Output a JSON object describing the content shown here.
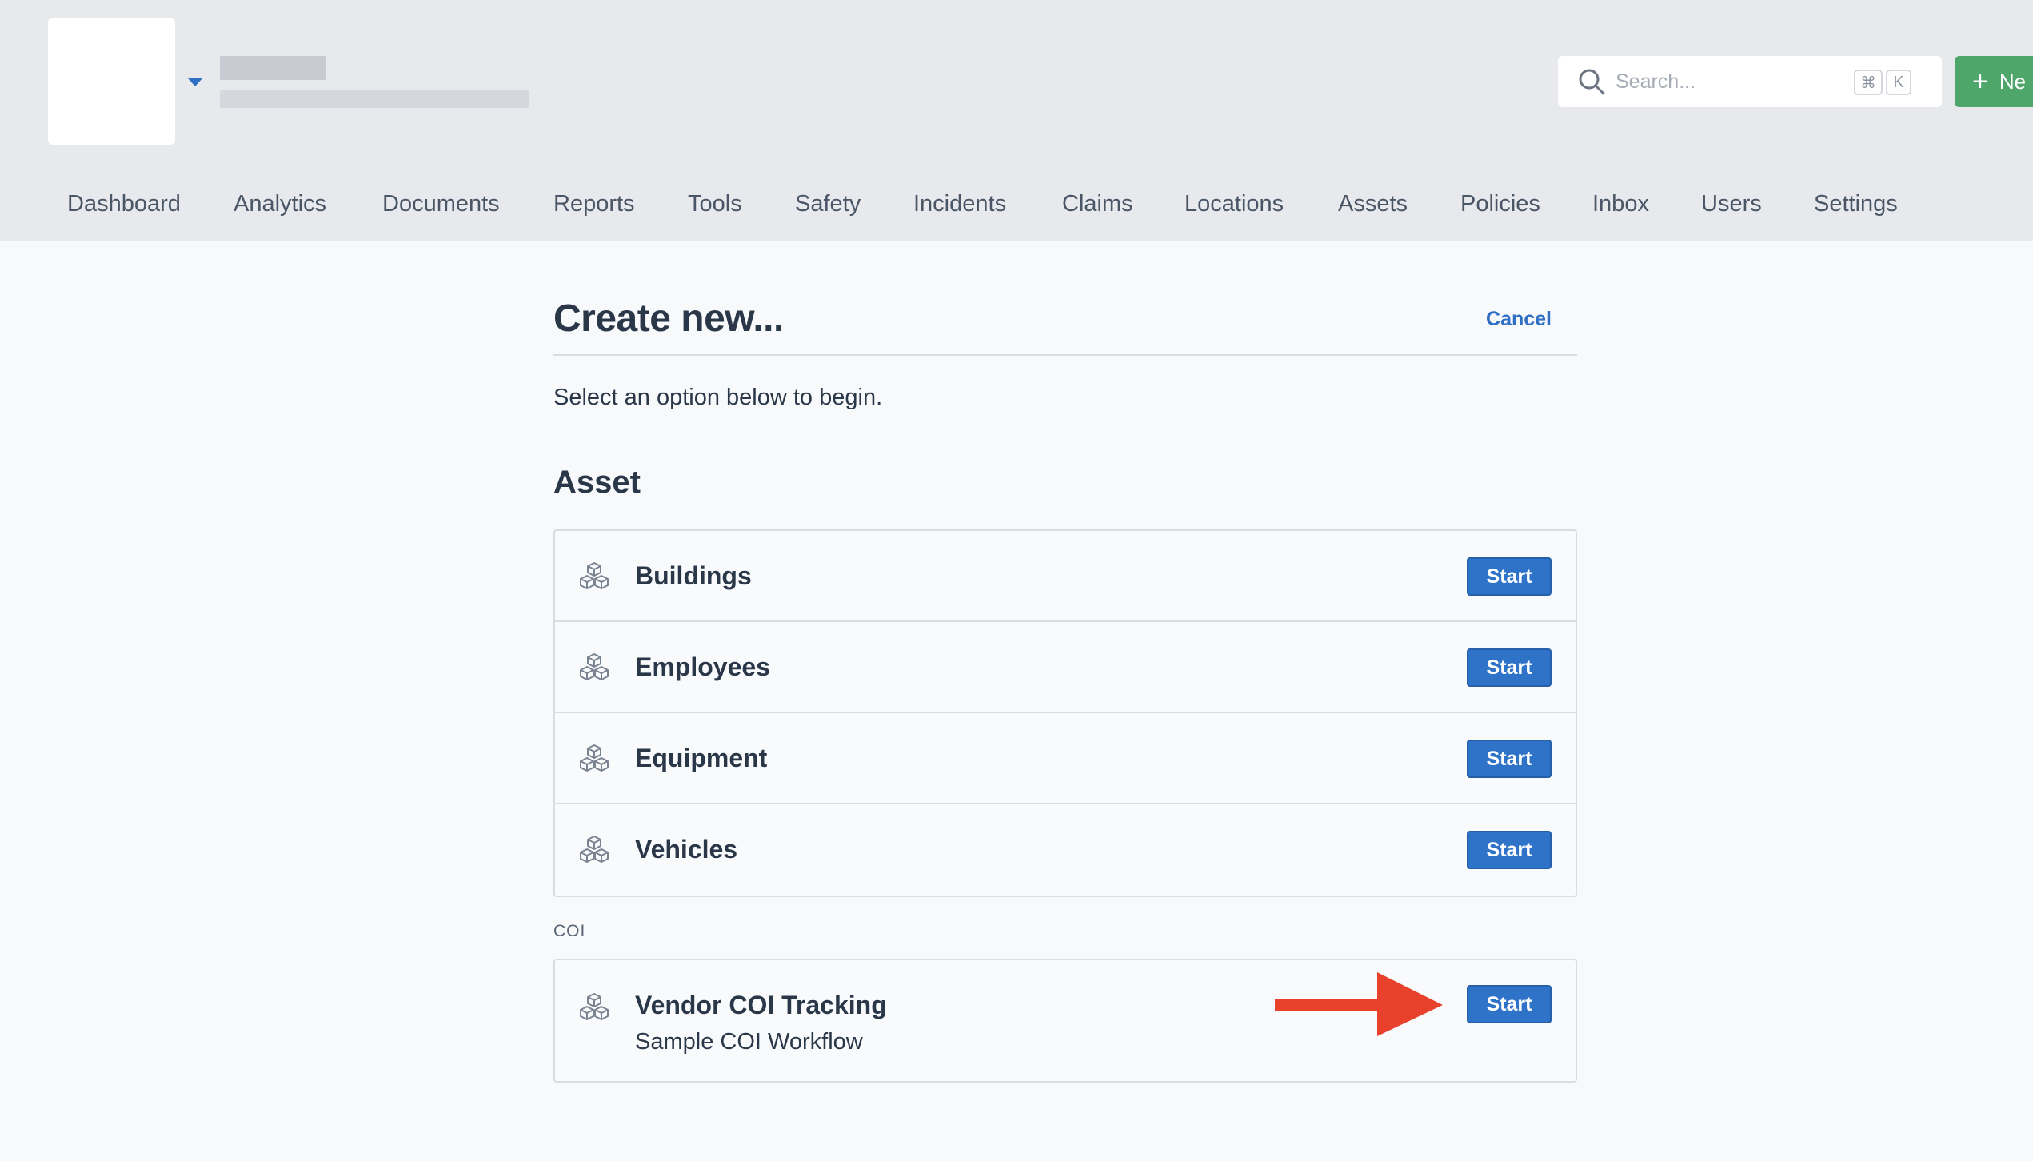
{
  "header": {
    "search": {
      "placeholder": "Search...",
      "shortcut_cmd": "⌘",
      "shortcut_key": "K"
    },
    "new_button_label": "Ne"
  },
  "nav": {
    "items": [
      {
        "label": "Dashboard"
      },
      {
        "label": "Analytics"
      },
      {
        "label": "Documents"
      },
      {
        "label": "Reports"
      },
      {
        "label": "Tools"
      },
      {
        "label": "Safety"
      },
      {
        "label": "Incidents"
      },
      {
        "label": "Claims"
      },
      {
        "label": "Locations"
      },
      {
        "label": "Assets"
      },
      {
        "label": "Policies"
      },
      {
        "label": "Inbox"
      },
      {
        "label": "Users"
      },
      {
        "label": "Settings"
      }
    ]
  },
  "page": {
    "title": "Create new...",
    "cancel_label": "Cancel",
    "intro": "Select an option below to begin."
  },
  "asset_section": {
    "heading": "Asset",
    "items": [
      {
        "label": "Buildings",
        "button": "Start"
      },
      {
        "label": "Employees",
        "button": "Start"
      },
      {
        "label": "Equipment",
        "button": "Start"
      },
      {
        "label": "Vehicles",
        "button": "Start"
      }
    ]
  },
  "coi_section": {
    "heading": "COI",
    "items": [
      {
        "label": "Vendor COI Tracking",
        "subtitle": "Sample COI Workflow",
        "button": "Start"
      }
    ]
  },
  "colors": {
    "accent_blue": "#2f73c8",
    "new_button_green": "#4fa66b",
    "annotation_arrow": "#e8412c"
  },
  "icons": {
    "row_icon": "boxes-icon",
    "search": "search-icon"
  }
}
